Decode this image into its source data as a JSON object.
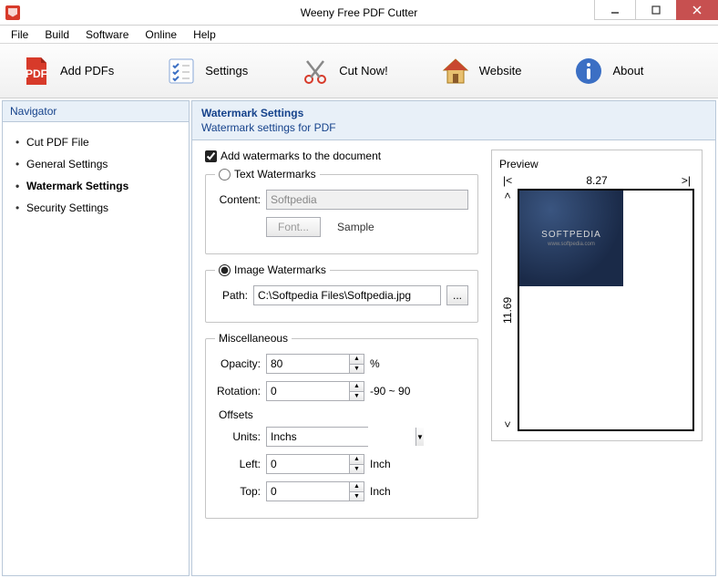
{
  "window": {
    "title": "Weeny Free PDF Cutter"
  },
  "menubar": {
    "file": "File",
    "build": "Build",
    "software": "Software",
    "online": "Online",
    "help": "Help"
  },
  "toolbar": {
    "add_pdfs": "Add PDFs",
    "settings": "Settings",
    "cut_now": "Cut Now!",
    "website": "Website",
    "about": "About"
  },
  "navigator": {
    "header": "Navigator",
    "items": [
      "Cut PDF File",
      "General Settings",
      "Watermark Settings",
      "Security Settings"
    ],
    "active_index": 2
  },
  "main": {
    "title": "Watermark Settings",
    "subtitle": "Watermark settings for PDF",
    "add_watermarks_label": "Add watermarks to the document",
    "add_watermarks_checked": true,
    "text_wm": {
      "legend": "Text Watermarks",
      "selected": false,
      "content_label": "Content:",
      "content_value": "Softpedia",
      "font_btn": "Font...",
      "sample_label": "Sample"
    },
    "image_wm": {
      "legend": "Image Watermarks",
      "selected": true,
      "path_label": "Path:",
      "path_value": "C:\\Softpedia Files\\Softpedia.jpg",
      "browse_btn": "..."
    },
    "misc": {
      "legend": "Miscellaneous",
      "opacity_label": "Opacity:",
      "opacity_value": "80",
      "opacity_unit": "%",
      "rotation_label": "Rotation:",
      "rotation_value": "0",
      "rotation_hint": "-90 ~ 90",
      "offsets_label": "Offsets",
      "units_label": "Units:",
      "units_value": "Inchs",
      "left_label": "Left:",
      "left_value": "0",
      "left_unit": "Inch",
      "top_label": "Top:",
      "top_value": "0",
      "top_unit": "Inch"
    },
    "preview": {
      "label": "Preview",
      "width": "8.27",
      "height": "11.69",
      "brand": "SOFTPEDIA",
      "brand_sub": "www.softpedia.com"
    }
  }
}
